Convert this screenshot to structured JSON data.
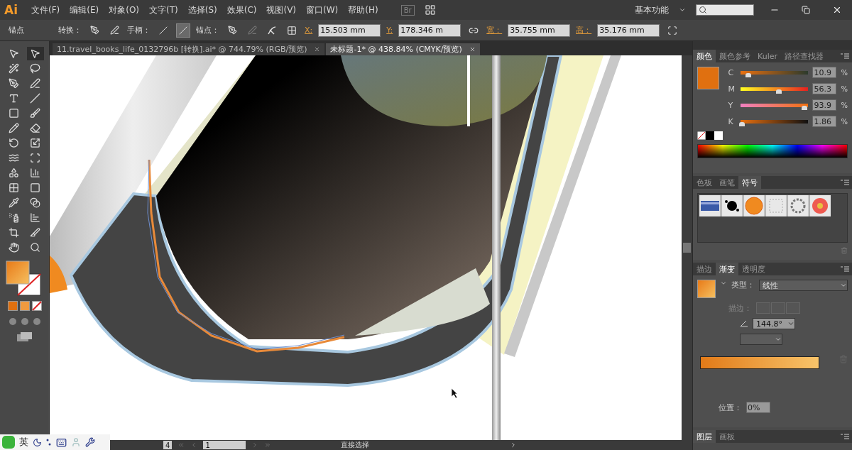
{
  "app": {
    "logo": "Ai",
    "bridge": "Br"
  },
  "menu": [
    "文件(F)",
    "编辑(E)",
    "对象(O)",
    "文字(T)",
    "选择(S)",
    "效果(C)",
    "视图(V)",
    "窗口(W)",
    "帮助(H)"
  ],
  "workspace": "基本功能",
  "control_bar": {
    "title": "锚点",
    "convert_label": "转换：",
    "handles_label": "手柄：",
    "handles": [
      {
        "selected": false
      },
      {
        "selected": true
      }
    ],
    "anchors_label": "锚点：",
    "fields": [
      {
        "label": "X:",
        "value": "15.503 mm"
      },
      {
        "label": "Y:",
        "value": "178.346 m"
      },
      {
        "label": "宽：",
        "value": "35.755 mm"
      },
      {
        "label": "高：",
        "value": "35.176 mm"
      }
    ]
  },
  "doc_tabs": [
    {
      "label": "11.travel_books_life_0132796b [转换].ai* @ 744.79% (RGB/预览)",
      "selected": false
    },
    {
      "label": "未标题-1* @ 438.84% (CMYK/预览)",
      "selected": true
    }
  ],
  "color_panel": {
    "tabs": [
      {
        "label": "颜色",
        "selected": true
      },
      {
        "label": "颜色参考",
        "selected": false
      },
      {
        "label": "Kuler",
        "selected": false
      },
      {
        "label": "路径查找器",
        "selected": false
      }
    ],
    "swatch": {
      "color": "#e07010"
    },
    "sliders": [
      {
        "label": "C",
        "value": "10.9",
        "level": 0.11
      },
      {
        "label": "M",
        "value": "56.3",
        "level": 0.56
      },
      {
        "label": "Y",
        "value": "93.9",
        "level": 0.94
      },
      {
        "label": "K",
        "value": "1.86",
        "level": 0.02
      }
    ],
    "unit": "%"
  },
  "symbol_panel": {
    "tabs": [
      {
        "label": "色板",
        "selected": false
      },
      {
        "label": "画笔",
        "selected": false
      },
      {
        "label": "符号",
        "selected": true
      }
    ]
  },
  "gradient_panel": {
    "tabs": [
      {
        "label": "描边",
        "selected": false
      },
      {
        "label": "渐变",
        "selected": true
      },
      {
        "label": "透明度",
        "selected": false
      }
    ],
    "type_label": "类型：",
    "type": "线性",
    "stroke_label": "描边：",
    "angle": "144.8°",
    "location_label": "位置：",
    "location": "0%"
  },
  "layers_panel": {
    "tabs": [
      {
        "label": "图层",
        "selected": true
      },
      {
        "label": "画板",
        "selected": false
      }
    ]
  },
  "status_bar": {
    "zoom": "4",
    "page": "1",
    "tool": "直接选择"
  },
  "ime": {
    "language": "英"
  }
}
